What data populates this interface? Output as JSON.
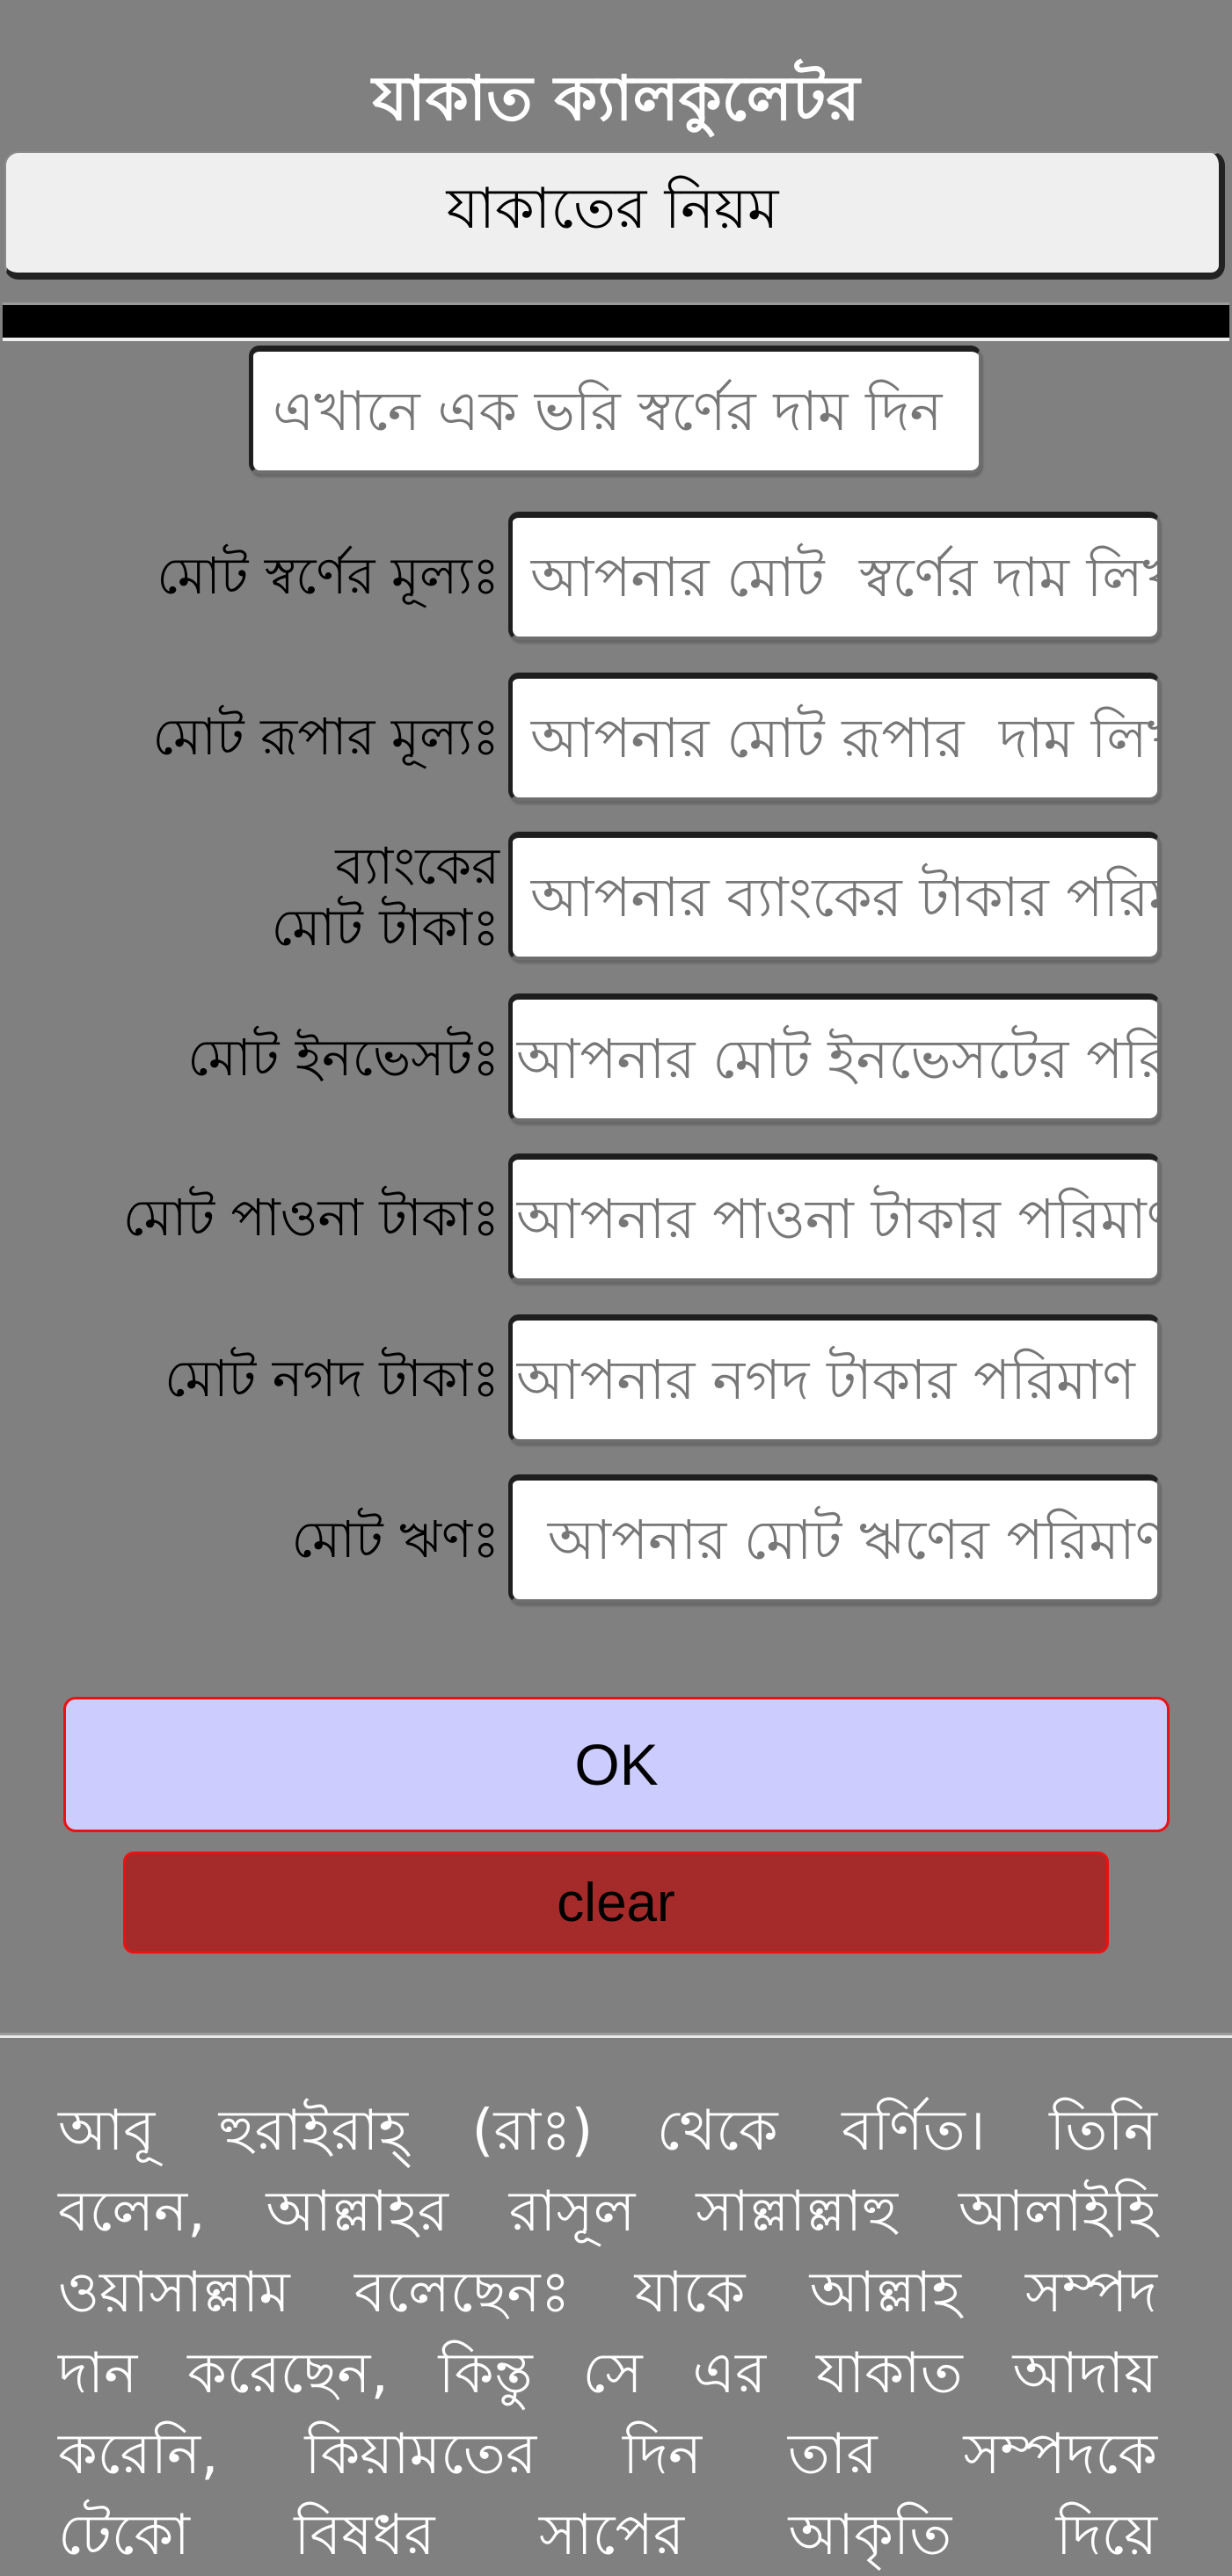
{
  "app": {
    "title": "যাকাত ক্যালকুলেটর"
  },
  "rules_button": {
    "label": "যাকাতের নিয়ম"
  },
  "gold_rate_input": {
    "placeholder": "এখানে এক ভরি স্বর্ণের দাম দিন",
    "value": ""
  },
  "form_rows": [
    {
      "label": "মোট স্বর্ণের মূল্যঃ",
      "placeholder": "আপনার মোট  স্বর্ণের দাম লিখুন",
      "value": ""
    },
    {
      "label": "মোট রূপার মূল্যঃ",
      "placeholder": "আপনার মোট রূপার  দাম লিখুন",
      "value": ""
    },
    {
      "label": "ব্যাংকের মোট টাকাঃ",
      "placeholder": "আপনার ব্যাংকের টাকার পরিমাণ",
      "value": ""
    },
    {
      "label": "মোট ইনভেসটঃ",
      "placeholder": "আপনার মোট ইনভেসটের পরিমাণ",
      "value": ""
    },
    {
      "label": "মোট পাওনা টাকাঃ",
      "placeholder": "আপনার পাওনা টাকার পরিমাণ",
      "value": ""
    },
    {
      "label": "মোট নগদ টাকাঃ",
      "placeholder": "আপনার নগদ টাকার পরিমাণ",
      "value": ""
    },
    {
      "label": "মোট ঋণঃ",
      "placeholder": " আপনার মোট ঋণের পরিমাণ",
      "value": ""
    }
  ],
  "buttons": {
    "ok_label": "OK",
    "clear_label": "clear"
  },
  "hadith": {
    "lines": [
      "আবূ হুরাইরাহ্ (রাঃ) থেকে বর্ণিত। তিনি",
      "বলেন, আল্লাহর রাসূল সাল্লাল্লাহু আলাইহি",
      "ওয়াসাল্লাম বলেছেনঃ যাকে আল্লাহ সম্পদ",
      "দান করেছেন, কিন্তু সে এর যাকাত আদায়",
      "করেনি, কিয়ামতের দিন তার সম্পদকে",
      "টেকো বিষধর সাপের আকৃতি দিয়ে"
    ]
  },
  "colors": {
    "page_background": "#808080",
    "ok_button": "#ccccff",
    "clear_button": "#a52a2a",
    "button_border": "#ee1111",
    "rules_button": "#efefef"
  }
}
